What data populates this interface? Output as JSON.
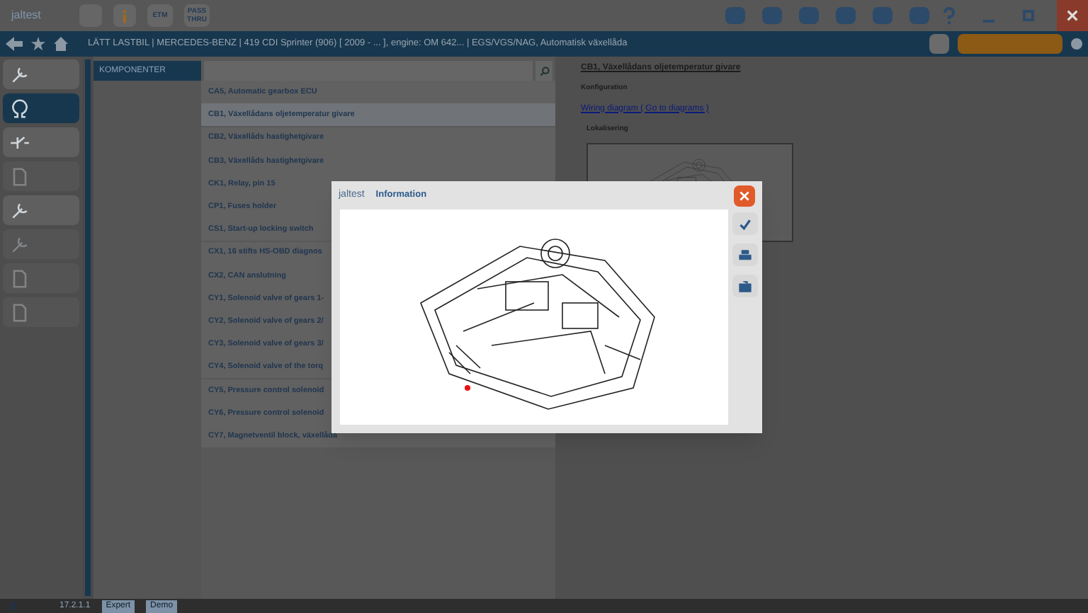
{
  "top_bar": {
    "logo": "jaltest",
    "tools": [
      "ETM",
      "PASS THRU"
    ]
  },
  "breadcrumb": "LÄTT LASTBIL | MERCEDES-BENZ | 419 CDI Sprinter (906) [ 2009 - ... ], engine: OM 642... | EGS/VGS/NAG, Automatisk växellåda",
  "sidebar": {
    "items": [
      {
        "kind": "tool",
        "selected": false,
        "disabled": false
      },
      {
        "kind": "omega",
        "selected": true,
        "disabled": false
      },
      {
        "kind": "diagram",
        "selected": false,
        "disabled": false
      },
      {
        "kind": "doc",
        "selected": false,
        "disabled": true
      },
      {
        "kind": "tool",
        "selected": false,
        "disabled": false
      },
      {
        "kind": "tool",
        "selected": false,
        "disabled": true
      },
      {
        "kind": "doc",
        "selected": false,
        "disabled": true
      },
      {
        "kind": "doc",
        "selected": false,
        "disabled": true
      }
    ]
  },
  "category": "KOMPONENTER",
  "components": [
    {
      "label": "CA5, Automatic gearbox ECU",
      "selected": false
    },
    {
      "label": "CB1, Växellådans oljetemperatur givare",
      "selected": true
    },
    {
      "label": "CB2, Växellåds hastighetgivare",
      "selected": false
    },
    {
      "label": "CB3, Växellåds hastighetgivare",
      "selected": false
    },
    {
      "label": "CK1, Relay, pin 15",
      "selected": false
    },
    {
      "label": "CP1, Fuses holder",
      "selected": false
    },
    {
      "label": "CS1, Start-up locking switch",
      "selected": false
    },
    {
      "label": "CX1, 16 stifts HS-OBD diagnos",
      "selected": false
    },
    {
      "label": "CX2, CAN anslutning",
      "selected": false
    },
    {
      "label": "CY1, Solenoid valve of gears 1-",
      "selected": false
    },
    {
      "label": "CY2, Solenoid valve of gears 2/",
      "selected": false
    },
    {
      "label": "CY3, Solenoid valve of gears 3/",
      "selected": false
    },
    {
      "label": "CY4, Solenoid valve of the torq",
      "selected": false
    },
    {
      "label": "CY5, Pressure control solenoid",
      "selected": false
    },
    {
      "label": "CY6, Pressure control solenoid",
      "selected": false
    },
    {
      "label": "CY7, Magnetventil block, växellåda",
      "selected": false
    }
  ],
  "detail": {
    "title": "CB1, Växellådans oljetemperatur givare",
    "section": "Konfiguration",
    "link": "Wiring diagram ( Go to diagrams )",
    "location_label": "Lokalisering"
  },
  "dialog": {
    "logo": "jaltest",
    "title": "Information"
  },
  "status_bar": {
    "version": "17.2.1.1",
    "modes": [
      "Expert",
      "Demo"
    ]
  }
}
